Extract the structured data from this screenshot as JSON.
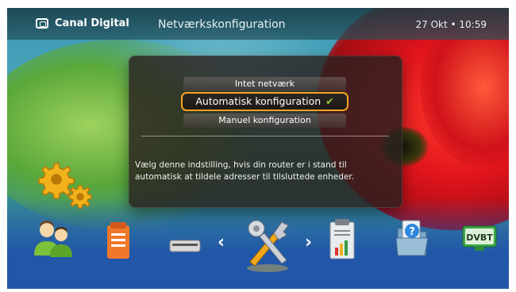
{
  "header": {
    "brand": "Canal Digital",
    "title": "Netværkskonfiguration",
    "datetime": "27 Okt • 10:59"
  },
  "dialog": {
    "options": [
      {
        "label": "Intet netværk",
        "selected": false
      },
      {
        "label": "Automatisk konfiguration",
        "selected": true
      },
      {
        "label": "Manuel konfiguration",
        "selected": false
      }
    ],
    "checkmark": "✔",
    "description": "Vælg denne indstilling, hvis din router er i stand til automatisk at tildele adresser til tilsluttede enheder."
  },
  "carousel": {
    "prev_arrow": "‹",
    "next_arrow": "›",
    "items": [
      {
        "icon": "users-icon"
      },
      {
        "icon": "clipboard-icon"
      },
      {
        "icon": "set-top-box-icon"
      },
      {
        "icon": "tools-icon",
        "active": true
      },
      {
        "icon": "report-icon"
      },
      {
        "icon": "help-folder-icon"
      },
      {
        "icon": "dvbt-icon",
        "text": "DVBT"
      }
    ]
  },
  "settings_icon": "gears-icon",
  "colors": {
    "accent": "#f5a320",
    "check": "#9bd23a"
  }
}
